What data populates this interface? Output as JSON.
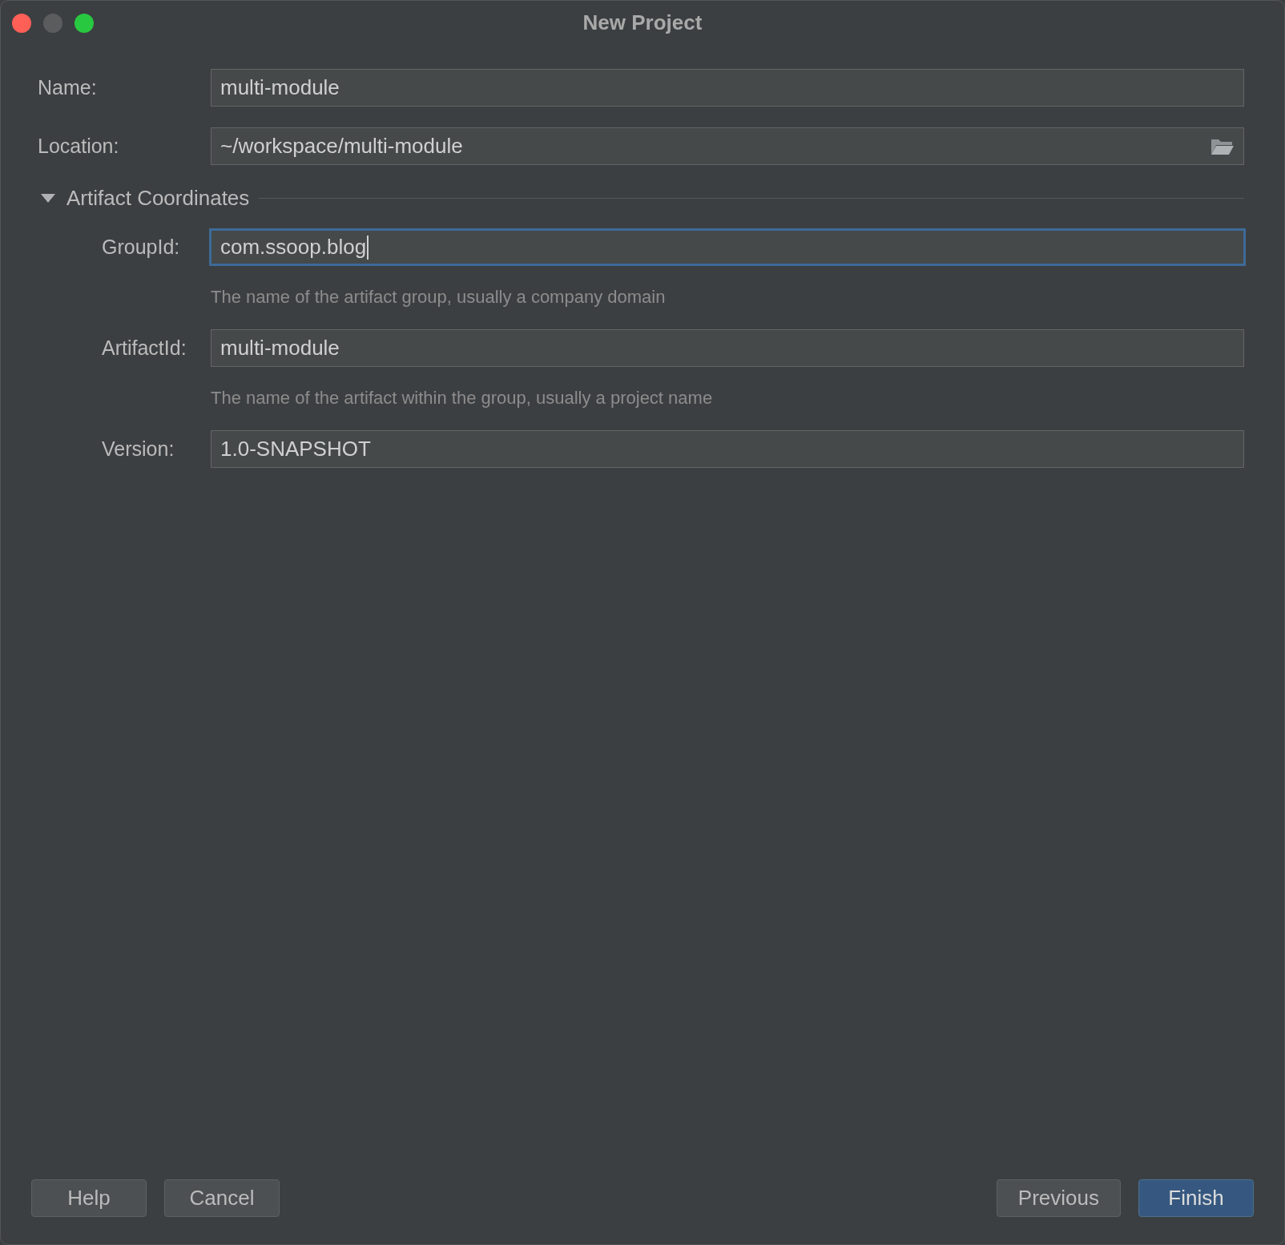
{
  "window": {
    "title": "New Project",
    "controls": [
      {
        "kind": "close",
        "disabled": false
      },
      {
        "kind": "minimize",
        "disabled": true
      },
      {
        "kind": "zoom",
        "disabled": false
      }
    ]
  },
  "fields": [
    {
      "label": "Name:",
      "value": "multi-module",
      "focused": false
    },
    {
      "label": "Location:",
      "value": "~/workspace/multi-module",
      "browse": true,
      "focused": false
    }
  ],
  "section": {
    "title": "Artifact Coordinates",
    "expanded": true,
    "fields": [
      {
        "label": "GroupId:",
        "value": "com.ssoop.blog",
        "focused": true,
        "hint": "The name of the artifact group, usually a company domain"
      },
      {
        "label": "ArtifactId:",
        "value": "multi-module",
        "focused": false,
        "hint": "The name of the artifact within the group, usually a project name"
      },
      {
        "label": "Version:",
        "value": "1.0-SNAPSHOT",
        "focused": false
      }
    ]
  },
  "buttons_left": [
    {
      "label": "Help",
      "default": false
    },
    {
      "label": "Cancel",
      "default": false
    }
  ],
  "buttons_right": [
    {
      "label": "Previous",
      "default": false
    },
    {
      "label": "Finish",
      "default": true
    }
  ]
}
